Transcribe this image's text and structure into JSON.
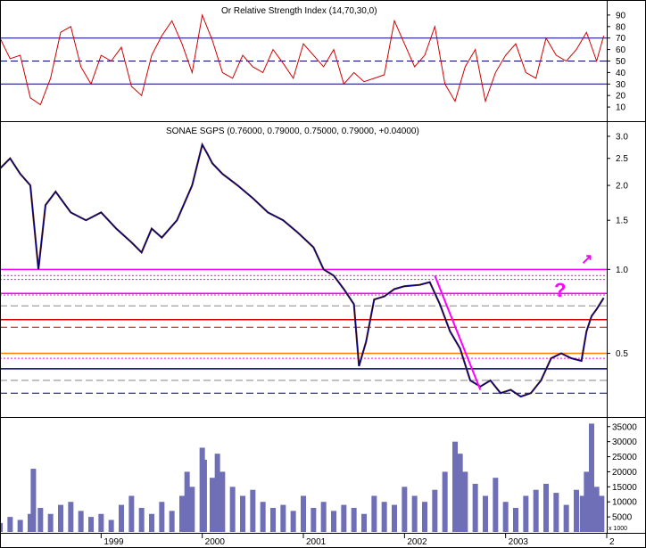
{
  "chart_data": [
    {
      "panel": "rsi",
      "type": "line",
      "title": "Or Relative Strength Index (14,70,30,0)",
      "ylim": [
        0,
        100
      ],
      "yticks": [
        10,
        20,
        30,
        40,
        50,
        60,
        70,
        80,
        90
      ],
      "levels": [
        {
          "value": 70,
          "style": "solid",
          "color": "#000080"
        },
        {
          "value": 50,
          "style": "dashed",
          "color": "#000080"
        },
        {
          "value": 30,
          "style": "solid",
          "color": "#000080"
        }
      ],
      "series": [
        {
          "color": "#d00000",
          "x": [
            1998.0,
            1998.1,
            1998.2,
            1998.3,
            1998.4,
            1998.5,
            1998.6,
            1998.7,
            1998.8,
            1998.9,
            1999.0,
            1999.1,
            1999.2,
            1999.3,
            1999.4,
            1999.5,
            1999.6,
            1999.7,
            1999.8,
            1999.9,
            2000.0,
            2000.1,
            2000.2,
            2000.3,
            2000.4,
            2000.5,
            2000.6,
            2000.7,
            2000.8,
            2000.9,
            2001.0,
            2001.1,
            2001.2,
            2001.3,
            2001.4,
            2001.5,
            2001.6,
            2001.7,
            2001.8,
            2001.9,
            2002.0,
            2002.1,
            2002.2,
            2002.3,
            2002.4,
            2002.5,
            2002.6,
            2002.7,
            2002.8,
            2002.9,
            2003.0,
            2003.1,
            2003.2,
            2003.3,
            2003.4,
            2003.5,
            2003.6,
            2003.7,
            2003.8,
            2003.9,
            2003.97
          ],
          "values": [
            70,
            52,
            55,
            18,
            12,
            35,
            75,
            80,
            45,
            30,
            55,
            50,
            62,
            28,
            20,
            55,
            72,
            85,
            65,
            40,
            90,
            68,
            40,
            35,
            55,
            45,
            40,
            60,
            48,
            35,
            65,
            55,
            45,
            60,
            30,
            40,
            32,
            35,
            38,
            85,
            65,
            45,
            55,
            80,
            30,
            15,
            45,
            60,
            15,
            40,
            55,
            65,
            40,
            35,
            70,
            55,
            50,
            60,
            75,
            50,
            72
          ]
        }
      ]
    },
    {
      "panel": "price",
      "type": "line",
      "title": "SONAE SGPS (0.76000, 0.79000, 0.75000, 0.79000, +0.04000)",
      "yscale": "log",
      "ylim": [
        0.3,
        3.3
      ],
      "yticks": [
        0.5,
        1.0,
        1.5,
        2.0,
        2.5,
        3.0
      ],
      "xticks": [
        "1999",
        "2000",
        "2001",
        "2002",
        "2003",
        "2"
      ],
      "annotations": [
        "?",
        "↗"
      ],
      "series": [
        {
          "color": "#000080",
          "x": [
            1998.0,
            1998.1,
            1998.2,
            1998.3,
            1998.38,
            1998.45,
            1998.55,
            1998.7,
            1998.85,
            1999.0,
            1999.15,
            1999.3,
            1999.4,
            1999.5,
            1999.6,
            1999.75,
            1999.9,
            2000.0,
            2000.05,
            2000.1,
            2000.2,
            2000.35,
            2000.5,
            2000.65,
            2000.8,
            2000.95,
            2001.1,
            2001.2,
            2001.3,
            2001.4,
            2001.5,
            2001.55,
            2001.62,
            2001.7,
            2001.8,
            2001.9,
            2002.0,
            2002.15,
            2002.25,
            2002.35,
            2002.45,
            2002.55,
            2002.65,
            2002.75,
            2002.85,
            2002.95,
            2003.05,
            2003.15,
            2003.25,
            2003.35,
            2003.45,
            2003.55,
            2003.65,
            2003.75,
            2003.8,
            2003.85,
            2003.9,
            2003.97
          ],
          "values": [
            2.3,
            2.5,
            2.2,
            2.0,
            1.0,
            1.7,
            1.9,
            1.6,
            1.5,
            1.6,
            1.4,
            1.25,
            1.15,
            1.4,
            1.3,
            1.5,
            2.0,
            2.8,
            2.6,
            2.4,
            2.2,
            2.0,
            1.8,
            1.6,
            1.5,
            1.35,
            1.2,
            1.0,
            0.95,
            0.85,
            0.75,
            0.45,
            0.55,
            0.78,
            0.8,
            0.85,
            0.87,
            0.88,
            0.9,
            0.75,
            0.6,
            0.52,
            0.4,
            0.38,
            0.4,
            0.36,
            0.37,
            0.35,
            0.36,
            0.4,
            0.48,
            0.5,
            0.48,
            0.47,
            0.6,
            0.68,
            0.72,
            0.79
          ]
        }
      ],
      "levels": [
        {
          "value": 1.0,
          "style": "solid",
          "color": "#ff00ff"
        },
        {
          "value": 0.95,
          "style": "dotted",
          "color": "#ff00ff"
        },
        {
          "value": 0.92,
          "style": "dotted",
          "color": "#ff00ff"
        },
        {
          "value": 0.82,
          "style": "solid",
          "color": "#ff00ff"
        },
        {
          "value": 0.81,
          "style": "dotted",
          "color": "#ff00ff"
        },
        {
          "value": 0.74,
          "style": "dashed",
          "color": "#888888"
        },
        {
          "value": 0.66,
          "style": "solid",
          "color": "#d00000"
        },
        {
          "value": 0.62,
          "style": "dashed",
          "color": "#d00000"
        },
        {
          "value": 0.5,
          "style": "solid",
          "color": "#ff8000"
        },
        {
          "value": 0.48,
          "style": "dotted",
          "color": "#ff00ff"
        },
        {
          "value": 0.44,
          "style": "solid",
          "color": "#000080"
        },
        {
          "value": 0.4,
          "style": "dashed",
          "color": "#888888"
        },
        {
          "value": 0.36,
          "style": "dashed",
          "color": "#000080"
        }
      ],
      "trendline": {
        "color": "#ff00ff",
        "x": [
          2002.3,
          2002.75
        ],
        "values": [
          0.95,
          0.37
        ]
      }
    },
    {
      "panel": "volume",
      "type": "bar",
      "ylim": [
        0,
        37000
      ],
      "yticks": [
        5000,
        10000,
        15000,
        20000,
        25000,
        30000,
        35000
      ],
      "ytick_labels": [
        "5000",
        "10000",
        "15000",
        "20000",
        "25000",
        "30000",
        "35000"
      ],
      "unit_label": "x 1000",
      "color": "#6f6fb8",
      "x": [
        1998.0,
        1998.1,
        1998.2,
        1998.3,
        1998.33,
        1998.4,
        1998.5,
        1998.6,
        1998.7,
        1998.8,
        1998.9,
        1999.0,
        1999.1,
        1999.2,
        1999.3,
        1999.4,
        1999.5,
        1999.6,
        1999.7,
        1999.8,
        1999.85,
        1999.9,
        2000.0,
        2000.02,
        2000.1,
        2000.15,
        2000.2,
        2000.3,
        2000.4,
        2000.5,
        2000.6,
        2000.7,
        2000.8,
        2000.9,
        2001.0,
        2001.1,
        2001.2,
        2001.3,
        2001.4,
        2001.5,
        2001.6,
        2001.7,
        2001.8,
        2001.9,
        2002.0,
        2002.1,
        2002.2,
        2002.3,
        2002.4,
        2002.5,
        2002.55,
        2002.6,
        2002.7,
        2002.8,
        2002.9,
        2003.0,
        2003.1,
        2003.2,
        2003.3,
        2003.4,
        2003.5,
        2003.6,
        2003.7,
        2003.76,
        2003.8,
        2003.85,
        2003.9,
        2003.95
      ],
      "values": [
        3000,
        5000,
        4000,
        6000,
        21000,
        8000,
        6000,
        9000,
        10000,
        7000,
        5000,
        6000,
        4000,
        9000,
        12000,
        8000,
        6000,
        10000,
        7000,
        12000,
        20000,
        15000,
        28000,
        24000,
        18000,
        26000,
        20000,
        15000,
        12000,
        14000,
        10000,
        8000,
        9000,
        7000,
        12000,
        8000,
        10000,
        7000,
        9000,
        8000,
        6000,
        12000,
        10000,
        9000,
        15000,
        12000,
        10000,
        14000,
        20000,
        30000,
        26000,
        20000,
        16000,
        12000,
        18000,
        10000,
        8000,
        12000,
        14000,
        16000,
        13000,
        9000,
        14000,
        12000,
        20000,
        36000,
        15000,
        12000
      ]
    }
  ]
}
